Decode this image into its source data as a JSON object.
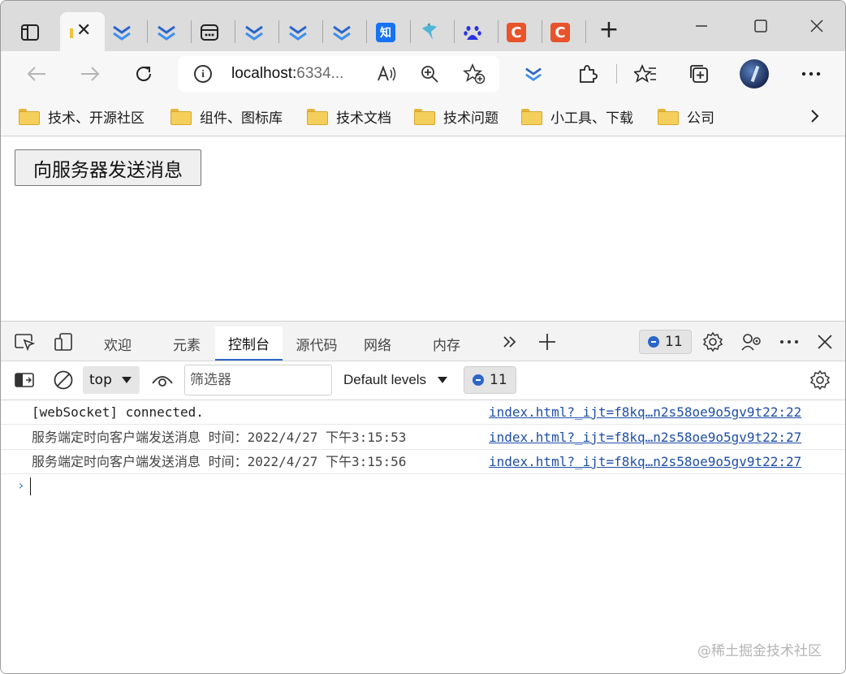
{
  "browser": {
    "tabs": {
      "active_close": "✕",
      "favicon_icons": [
        "edge-devtools-icon",
        "edge-devtools-icon",
        "app-window-icon",
        "edge-devtools-icon",
        "edge-devtools-icon",
        "edge-devtools-icon",
        "zhihu-icon",
        "bird-icon",
        "baidu-icon",
        "csdn-icon",
        "csdn-icon"
      ],
      "zhihu_label": "知",
      "csdn_label": "C",
      "new_tab": "+"
    },
    "address": {
      "host": "localhost:",
      "port": "6334..."
    },
    "bookmarks": [
      "技术、开源社区",
      "组件、图标库",
      "技术文档",
      "技术问题",
      "小工具、下载",
      "公司"
    ]
  },
  "page": {
    "send_button": "向服务器发送消息"
  },
  "devtools": {
    "tabs": [
      "欢迎",
      "元素",
      "控制台",
      "源代码",
      "网络",
      "内存"
    ],
    "active_tab": "控制台",
    "issues_count": "11",
    "context": "top",
    "filter_placeholder": "筛选器",
    "levels": "Default levels",
    "messages_count": "11",
    "logs": [
      {
        "text": "[webSocket] connected.",
        "source": "index.html?_ijt=f8kq…n2s58oe9o5gv9t22:22"
      },
      {
        "text": "服务端定时向客户端发送消息 时间：2022/4/27 下午3:15:53",
        "source": "index.html?_ijt=f8kq…n2s58oe9o5gv9t22:27"
      },
      {
        "text": "服务端定时向客户端发送消息 时间：2022/4/27 下午3:15:56",
        "source": "index.html?_ijt=f8kq…n2s58oe9o5gv9t22:27"
      }
    ],
    "prompt": "›"
  },
  "watermark": "@稀土掘金技术社区",
  "colors": {
    "accent": "#2a66c8",
    "link": "#1f4ea8",
    "csdn": "#e8532b",
    "zhihu": "#1772f6",
    "baidu": "#2932e1"
  }
}
